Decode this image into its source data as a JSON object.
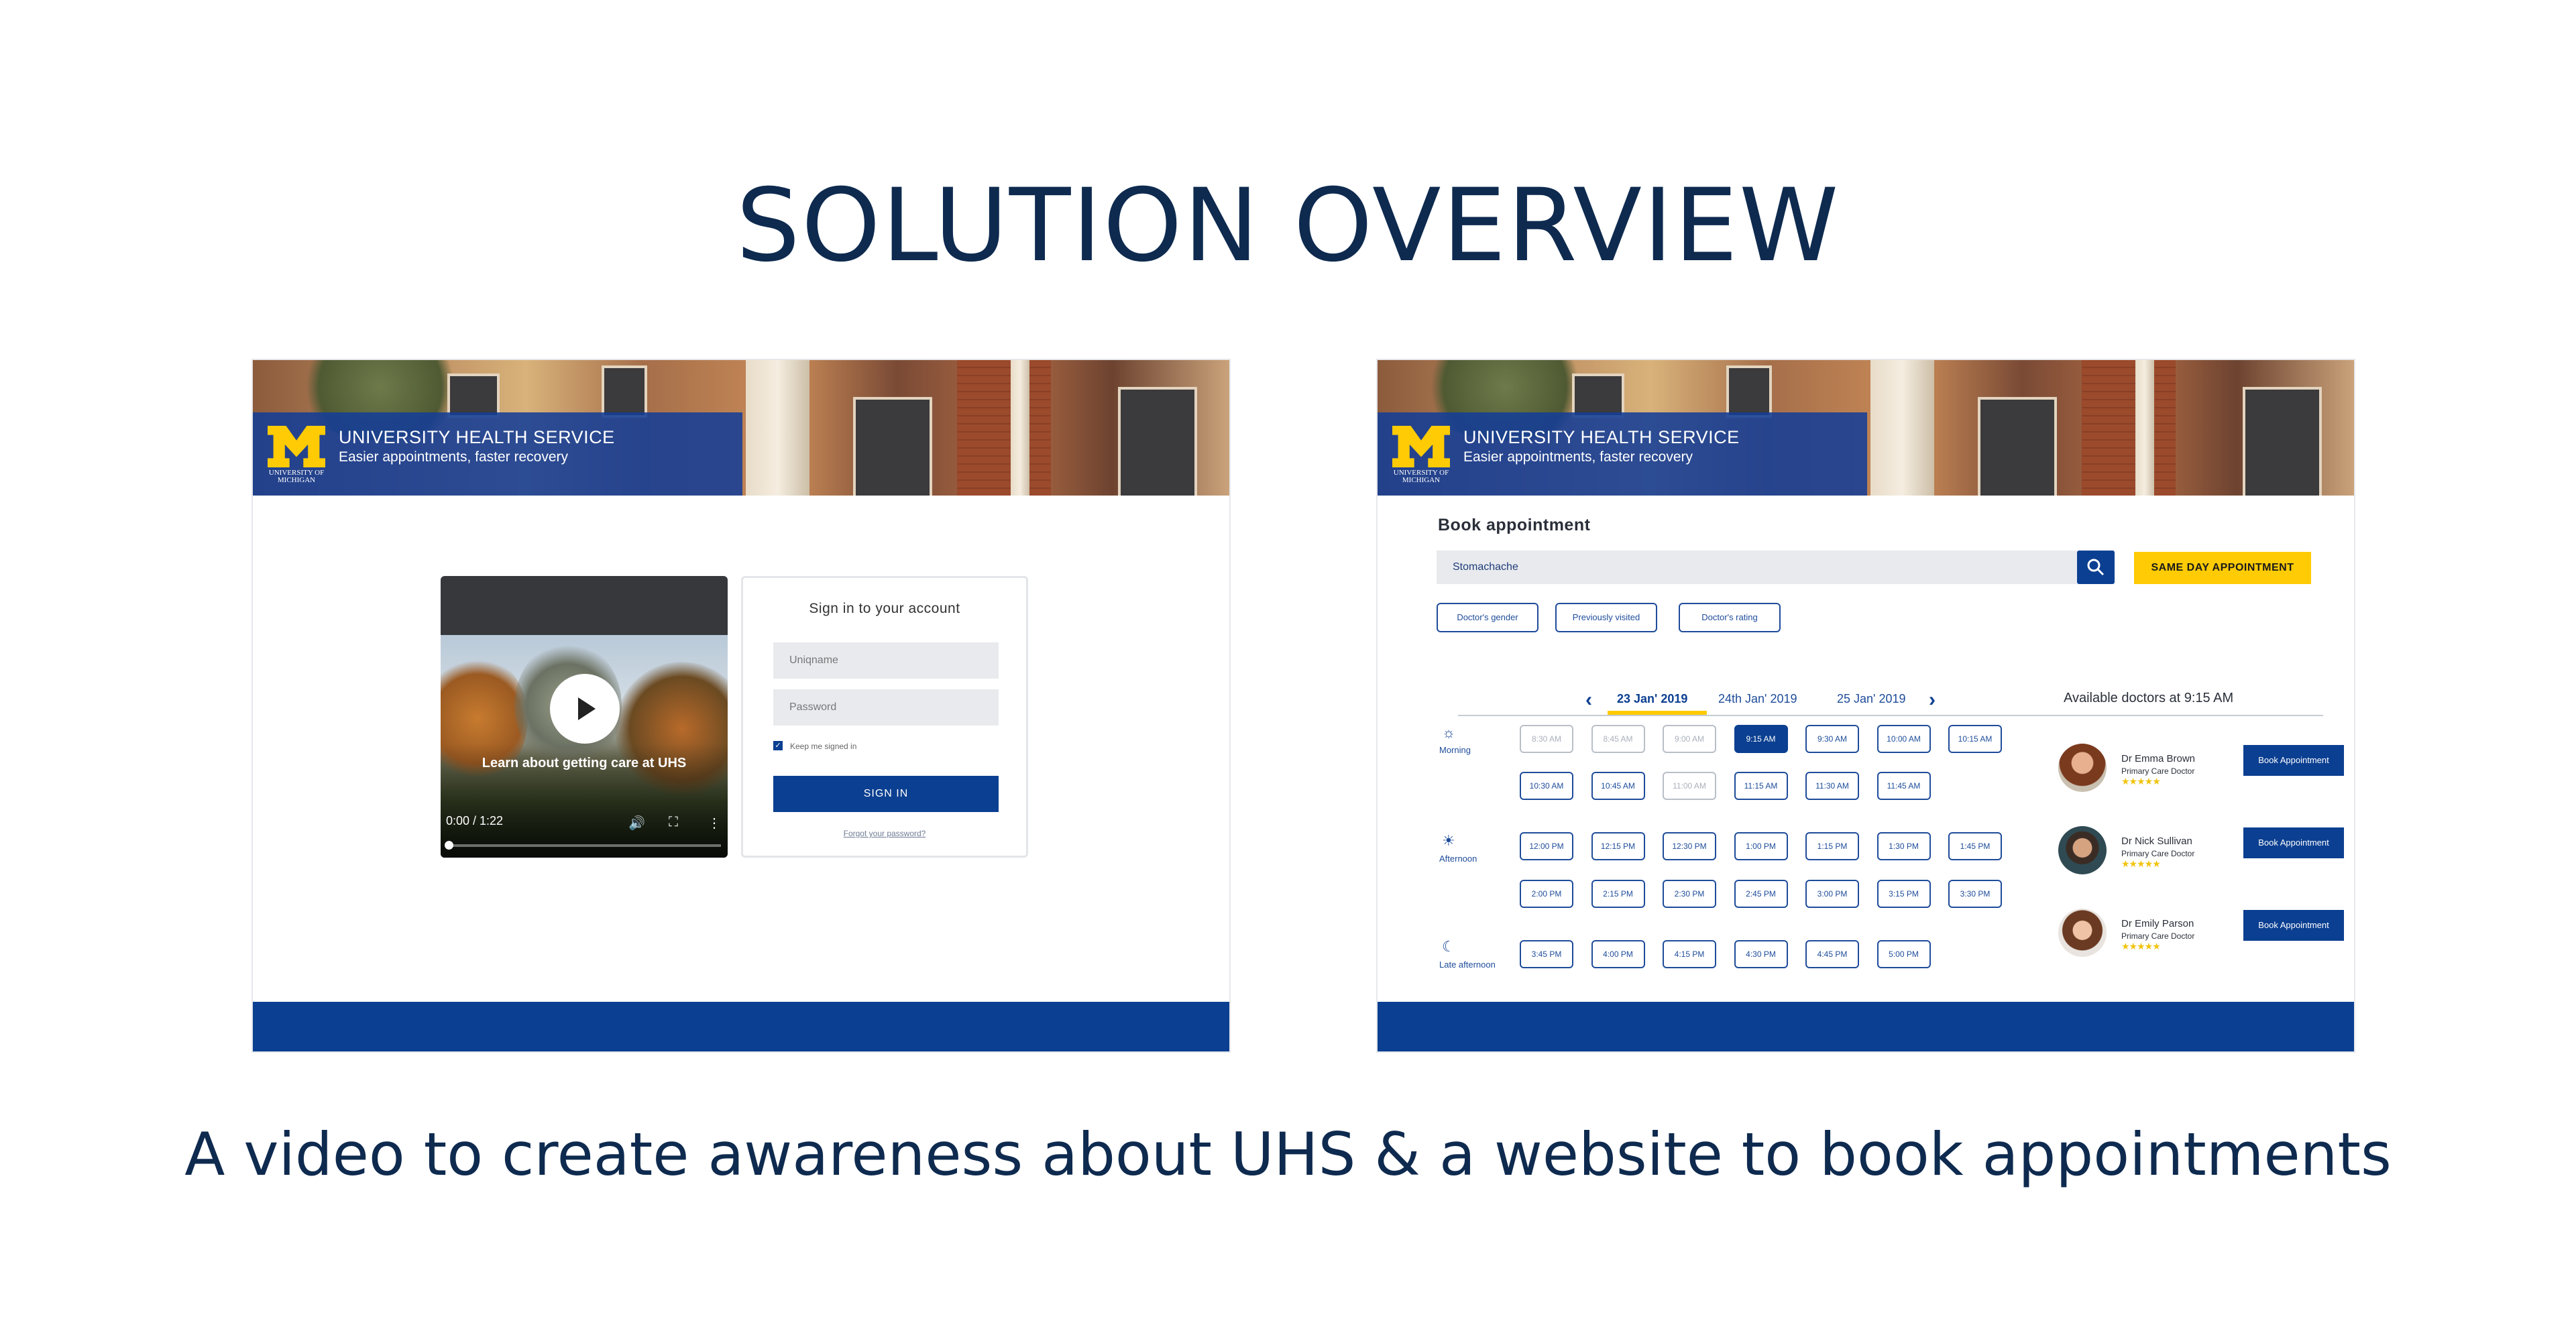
{
  "title": "SOLUTION OVERVIEW",
  "subtitle": "A video to create awareness about UHS & a website to book appointments",
  "brand": {
    "logo_text_1": "UNIVERSITY OF",
    "logo_text_2": "MICHIGAN",
    "name": "UNIVERSITY HEALTH SERVICE",
    "tagline": "Easier appointments, faster recovery"
  },
  "video": {
    "caption": "Learn about getting care at UHS",
    "time": "0:00 / 1:22",
    "progress": 0
  },
  "signin": {
    "title": "Sign in to your account",
    "uniqname_placeholder": "Uniqname",
    "password_placeholder": "Password",
    "keep_signed_in": "Keep me signed in",
    "button": "SIGN IN",
    "forgot": "Forgot your password?"
  },
  "booking": {
    "title": "Book appointment",
    "search_value": "Stomachache",
    "same_day": "SAME DAY APPOINTMENT",
    "filters": [
      "Doctor's gender",
      "Previously visited",
      "Doctor's rating"
    ],
    "dates": [
      "23 Jan' 2019",
      "24th Jan' 2019",
      "25 Jan' 2019"
    ],
    "available_label": "Available doctors at 9:15 AM",
    "periods": [
      "Morning",
      "Afternoon",
      "Late afternoon"
    ],
    "morning_row1": [
      "8:30 AM",
      "8:45 AM",
      "9:00 AM",
      "9:15 AM",
      "9:30 AM",
      "10:00 AM",
      "10:15 AM"
    ],
    "morning_row2": [
      "10:30 AM",
      "10:45 AM",
      "11:00 AM",
      "11:15 AM",
      "11:30 AM",
      "11:45 AM"
    ],
    "afternoon_row1": [
      "12:00 PM",
      "12:15 PM",
      "12:30 PM",
      "1:00 PM",
      "1:15 PM",
      "1:30 PM",
      "1:45 PM"
    ],
    "afternoon_row2": [
      "2:00 PM",
      "2:15 PM",
      "2:30 PM",
      "2:45 PM",
      "3:00 PM",
      "3:15 PM",
      "3:30 PM"
    ],
    "late_row": [
      "3:45 PM",
      "4:00 PM",
      "4:15 PM",
      "4:30 PM",
      "4:45 PM",
      "5:00 PM"
    ],
    "doctors": [
      {
        "name": "Dr Emma Brown",
        "role": "Primary Care Doctor",
        "stars": "★★★★★",
        "button": "Book Appointment"
      },
      {
        "name": "Dr Nick Sullivan",
        "role": "Primary Care Doctor",
        "stars": "★★★★★",
        "button": "Book Appointment"
      },
      {
        "name": "Dr Emily Parson",
        "role": "Primary Care Doctor",
        "stars": "★★★★★",
        "button": "Book Appointment"
      }
    ]
  },
  "colors": {
    "navy": "#0b3f91",
    "maize": "#ffcb05",
    "heading": "#0e2a4f"
  }
}
